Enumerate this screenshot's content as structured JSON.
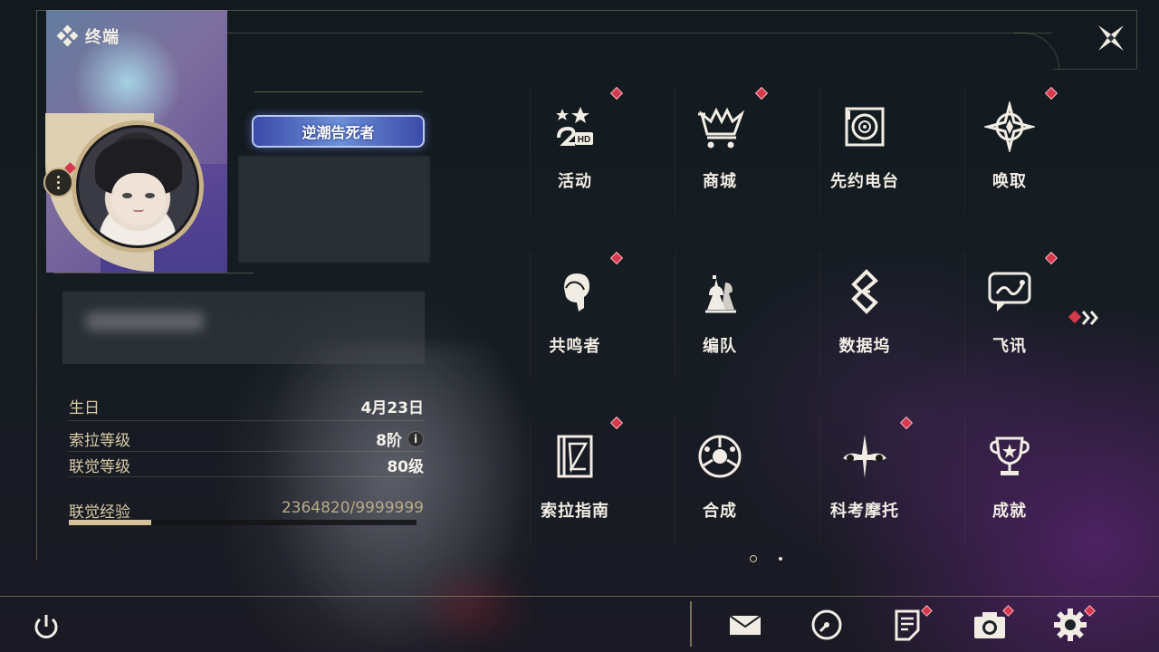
{
  "header": {
    "title": "终端",
    "title_icon": "diamond-cluster-icon",
    "close_icon": "close-icon"
  },
  "profile": {
    "more_icon": "more-dots-icon",
    "player_title": "逆潮告死者",
    "stats": [
      {
        "label": "生日",
        "value": "4月23日"
      },
      {
        "label": "索拉等级",
        "value": "8阶",
        "info": "i"
      },
      {
        "label": "联觉等级",
        "value": "80级"
      }
    ],
    "exp": {
      "label": "联觉经验",
      "value": "2364820/9999999",
      "progress": 0.236
    }
  },
  "grid": {
    "items": [
      {
        "label": "活动",
        "icon": "event-icon",
        "notif": true
      },
      {
        "label": "商城",
        "icon": "shop-cart-icon",
        "notif": true
      },
      {
        "label": "先约电台",
        "icon": "radio-icon",
        "notif": false
      },
      {
        "label": "唤取",
        "icon": "convene-icon",
        "notif": true
      },
      {
        "label": "共鸣者",
        "icon": "resonator-icon",
        "notif": true
      },
      {
        "label": "编队",
        "icon": "chess-team-icon",
        "notif": false
      },
      {
        "label": "数据坞",
        "icon": "data-bank-icon",
        "notif": false
      },
      {
        "label": "飞讯",
        "icon": "message-icon",
        "notif": true
      },
      {
        "label": "索拉指南",
        "icon": "guidebook-icon",
        "notif": true
      },
      {
        "label": "合成",
        "icon": "synthesis-icon",
        "notif": false
      },
      {
        "label": "科考摩托",
        "icon": "motorcycle-icon",
        "notif": true
      },
      {
        "label": "成就",
        "icon": "trophy-icon",
        "notif": false
      }
    ],
    "next_icon": "double-chevron-right-icon",
    "pages": {
      "current": 1,
      "total": 2
    }
  },
  "bottom_bar": {
    "power_icon": "power-icon",
    "icons": [
      "mail-icon",
      "clock-icon",
      "notes-icon",
      "camera-icon",
      "settings-gear-icon"
    ]
  },
  "colors": {
    "accent": "#c7b387",
    "notification": "#d6384c",
    "text": "#f1ede4",
    "label_gold": "#d8cba6"
  }
}
